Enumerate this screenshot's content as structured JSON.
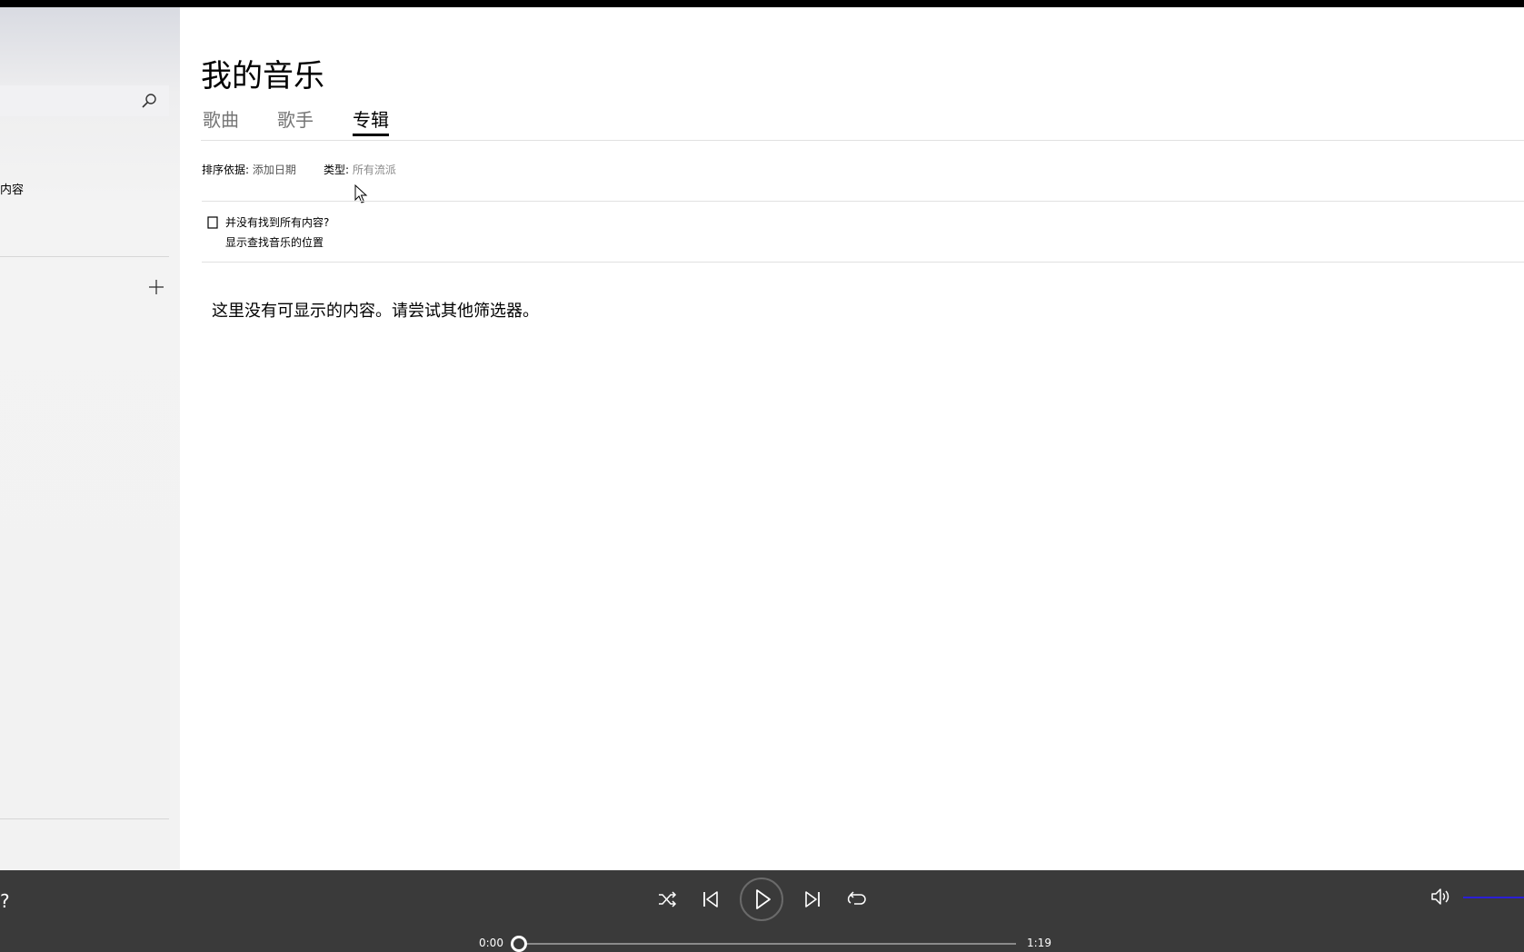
{
  "sidebar": {
    "all_content_label": "内容",
    "help_label": "?"
  },
  "main": {
    "title": "我的音乐",
    "tabs": [
      {
        "label": "歌曲",
        "active": false
      },
      {
        "label": "歌手",
        "active": false
      },
      {
        "label": "专辑",
        "active": true
      }
    ],
    "filters": {
      "sort_label": "排序依据:",
      "sort_value": "添加日期",
      "type_label": "类型:",
      "type_value": "所有流派"
    },
    "missing": {
      "title": "并没有找到所有内容?",
      "link": "显示查找音乐的位置"
    },
    "empty_message": "这里没有可显示的内容。请尝试其他筛选器。"
  },
  "player": {
    "time_current": "0:00",
    "time_total": "1:19",
    "progress": 0,
    "icons": [
      "shuffle-icon",
      "previous-icon",
      "play-icon",
      "next-icon",
      "repeat-icon",
      "volume-icon"
    ]
  },
  "colors": {
    "player_bg": "#3a3a3a",
    "volume_accent": "#2b1fd6"
  }
}
